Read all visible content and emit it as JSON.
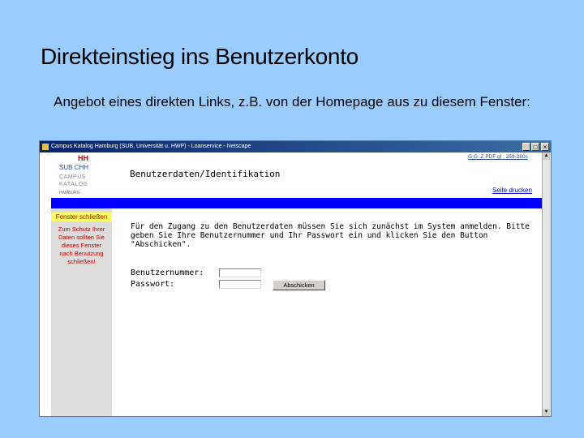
{
  "slide": {
    "title": "Direkteinstieg ins Benutzerkonto",
    "subtitle": "Angebot eines direkten Links, z.B. von der Homepage aus zu diesem Fenster:"
  },
  "browser": {
    "window_title": "Campus Katalog Hamburg (SUB, Universität u. HWP) - Loanservice - Netscape",
    "controls": {
      "minimize": "_",
      "maximize": "□",
      "close": "×"
    }
  },
  "sidebar": {
    "logo_hh": "HH",
    "logo_sub": "SUB   CHH",
    "logo_campus": "CAMPUS\nKATALOG",
    "logo_tiny": "HAMBURG",
    "close_window": "Fenster schließen",
    "close_note": "Zum Schutz Ihrer Daten sollten Sie dieses Fenster nach Benutzung schließen!"
  },
  "page": {
    "top_links": "G.G. Z PDF gl  . 259-280s",
    "heading": "Benutzerdaten/Identifikation",
    "print_link": "Seite drucken",
    "instructions": "Für den Zugang zu den Benutzerdaten müssen Sie sich zunächst im System anmelden. Bitte geben Sie Ihre Benutzernummer und Ihr Passwort ein und klicken Sie den Button \"Abschicken\"."
  },
  "form": {
    "user_label": "Benutzernummer:",
    "user_value": "",
    "password_label": "Passwort:",
    "password_value": "",
    "submit_label": "Abschicken"
  }
}
